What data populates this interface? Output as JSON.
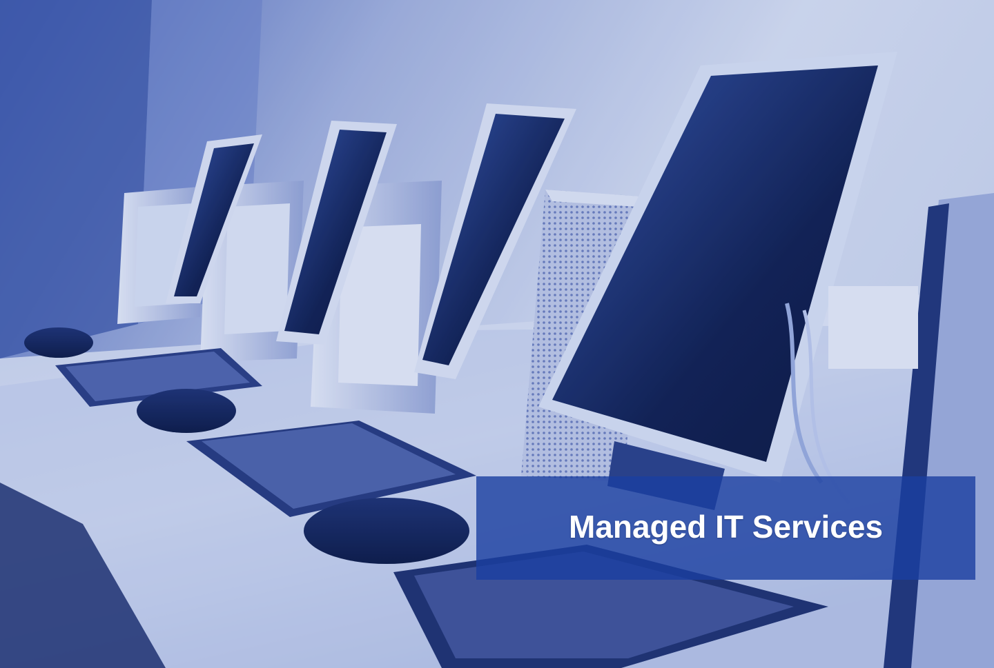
{
  "banner": {
    "caption": "Managed IT Services",
    "overlay_color": "#1a3fa0",
    "caption_color": "#ffffff"
  },
  "photo": {
    "subject": "row-of-computer-workstations",
    "tint_color": "#2b4fb0"
  }
}
